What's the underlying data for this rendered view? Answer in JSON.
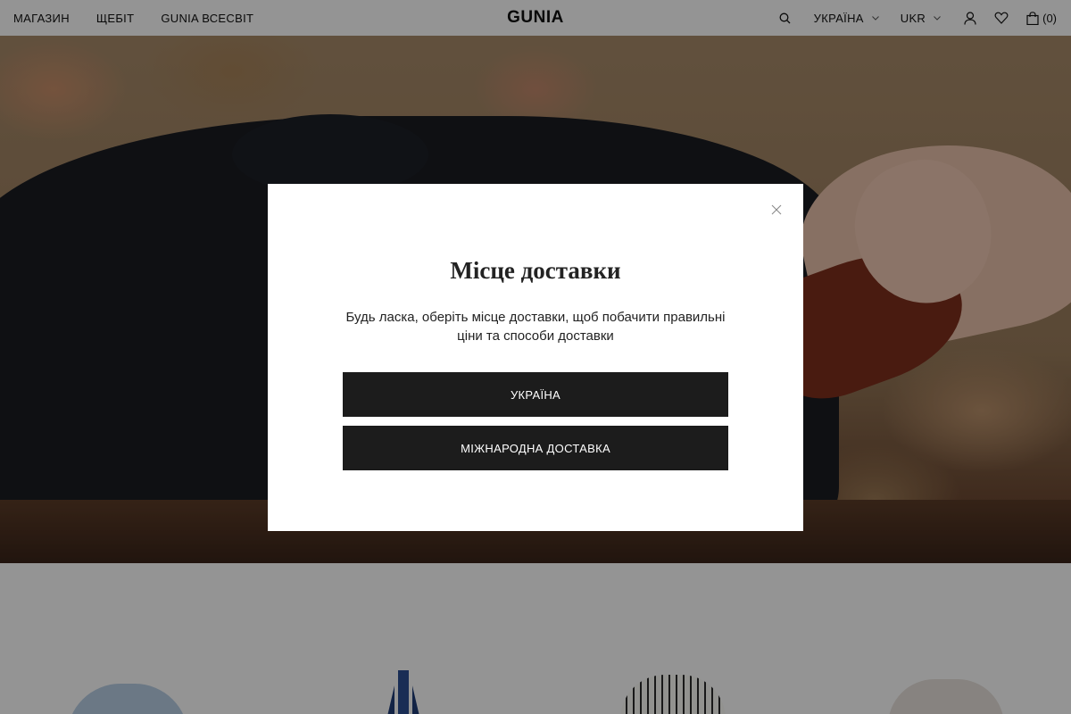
{
  "header": {
    "nav": [
      "МАГАЗИН",
      "ЩЕБІТ",
      "GUNIA ВСЕСВІТ"
    ],
    "logo": "GUNIA",
    "country": "УКРАЇНА",
    "currency": "UKR",
    "cart_count": "(0)",
    "icons": [
      "search-icon",
      "chevron-down-icon",
      "account-icon",
      "heart-icon",
      "bag-icon"
    ]
  },
  "modal": {
    "title": "Місце доставки",
    "text": "Будь ласка, оберіть місце доставки, щоб побачити правильні ціни та способи доставки",
    "buttons": [
      "УКРАЇНА",
      "МІЖНАРОДНА ДОСТАВКА"
    ],
    "close_icon": "close-icon"
  },
  "colors": {
    "overlay": "rgba(0,0,0,0.42)",
    "button": "#1c1c1c"
  }
}
